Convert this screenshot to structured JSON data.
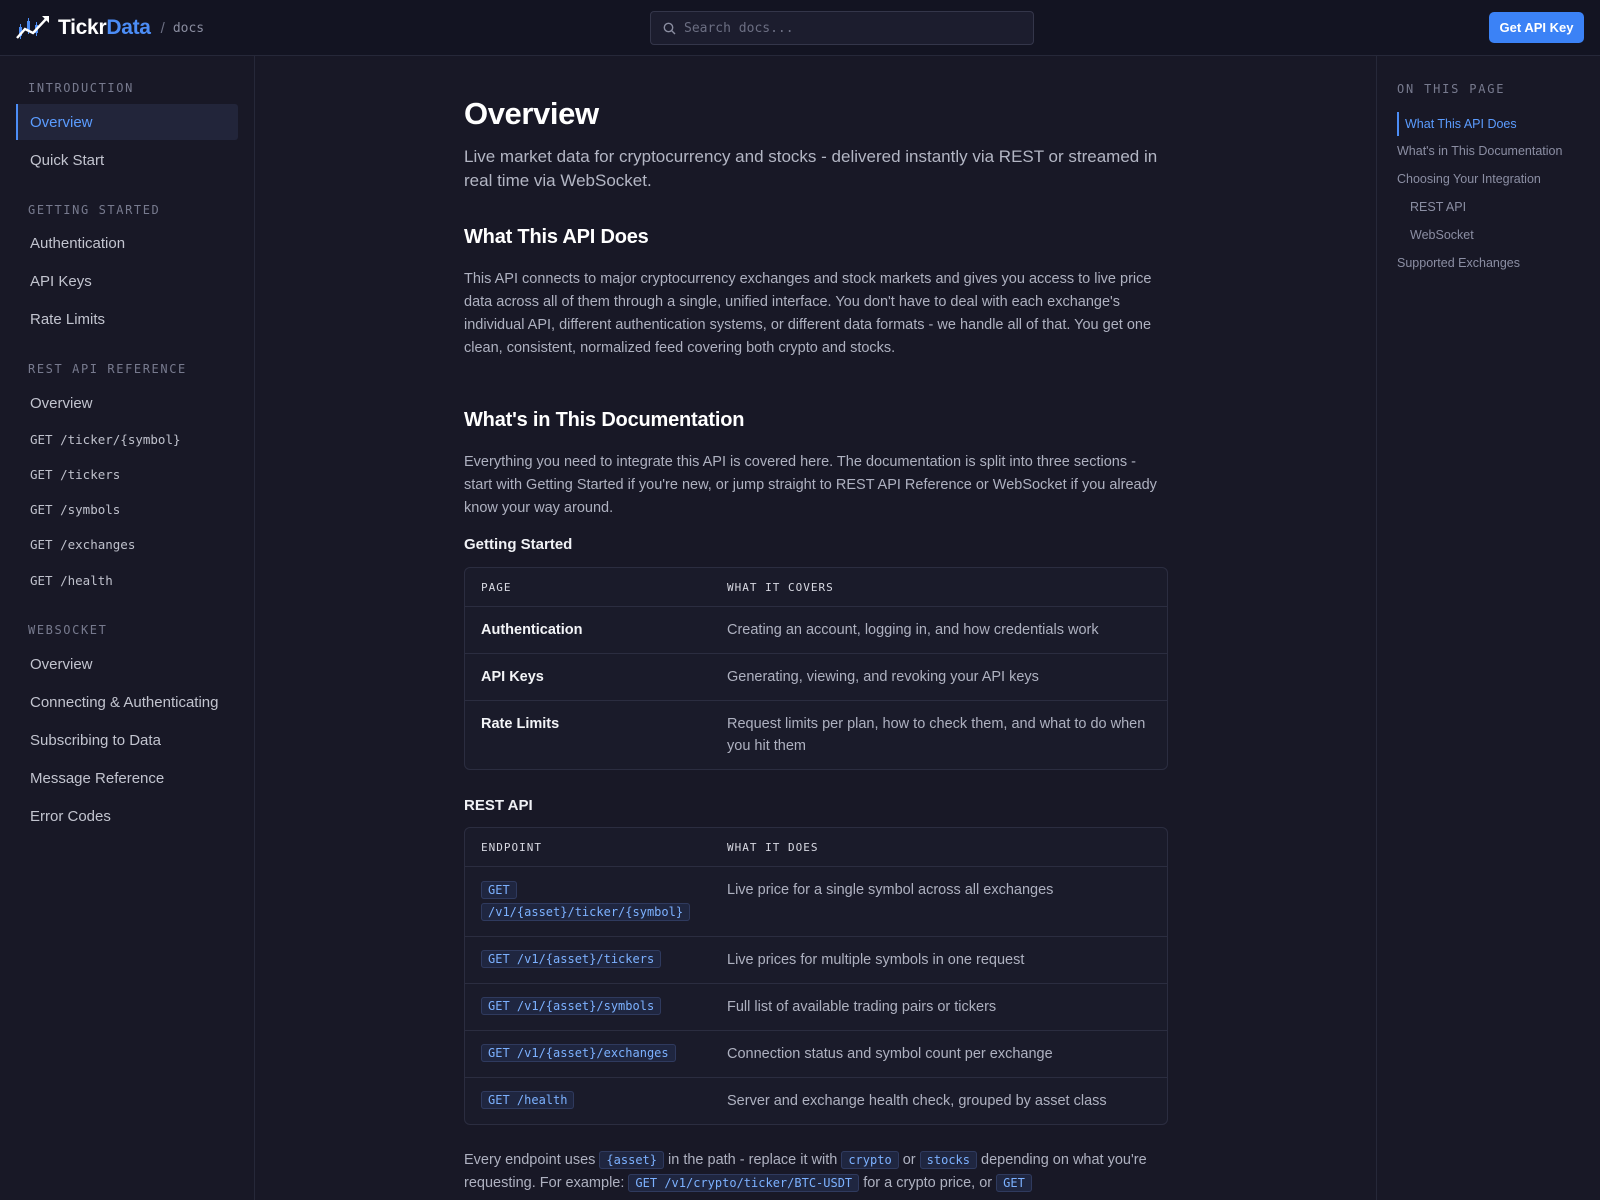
{
  "header": {
    "brand_part1": "Tickr",
    "brand_part2": "Data",
    "crumb_sep": "/",
    "crumb": "docs",
    "search_placeholder": "Search docs...",
    "cta_label": "Get API Key"
  },
  "sidebar": {
    "sections": [
      {
        "title": "INTRODUCTION",
        "items": [
          "Overview",
          "Quick Start"
        ]
      },
      {
        "title": "GETTING STARTED",
        "items": [
          "Authentication",
          "API Keys",
          "Rate Limits"
        ]
      },
      {
        "title": "REST API REFERENCE",
        "items": [
          "Overview",
          "GET /ticker/{symbol}",
          "GET /tickers",
          "GET /symbols",
          "GET /exchanges",
          "GET /health"
        ]
      },
      {
        "title": "WEBSOCKET",
        "items": [
          "Overview",
          "Connecting & Authenticating",
          "Subscribing to Data",
          "Message Reference",
          "Error Codes"
        ]
      }
    ]
  },
  "toc": {
    "title": "ON THIS PAGE",
    "items": [
      "What This API Does",
      "What's in This Documentation",
      "Choosing Your Integration",
      "REST API",
      "WebSocket",
      "Supported Exchanges"
    ]
  },
  "content": {
    "title": "Overview",
    "lead": "Live market data for cryptocurrency and stocks - delivered instantly via REST or streamed in real time via WebSocket.",
    "h2_what": "What This API Does",
    "p_what": "This API connects to major cryptocurrency exchanges and stock markets and gives you access to live price data across all of them through a single, unified interface. You don't have to deal with each exchange's individual API, different authentication systems, or different data formats - we handle all of that. You get one clean, consistent, normalized feed covering both crypto and stocks.",
    "h2_docs": "What's in This Documentation",
    "p_docs": "Everything you need to integrate this API is covered here. The documentation is split into three sections - start with Getting Started if you're new, or jump straight to REST API Reference or WebSocket if you already know your way around.",
    "h3_getting": "Getting Started",
    "table1": {
      "col1": "PAGE",
      "col2": "WHAT IT COVERS",
      "rows": [
        [
          "Authentication",
          "Creating an account, logging in, and how credentials work"
        ],
        [
          "API Keys",
          "Generating, viewing, and revoking your API keys"
        ],
        [
          "Rate Limits",
          "Request limits per plan, how to check them, and what to do when you hit them"
        ]
      ]
    },
    "h3_rest": "REST API",
    "table2": {
      "col1": "ENDPOINT",
      "col2": "WHAT IT DOES",
      "row1_code_a": "GET",
      "row1_code_b": "/v1/{asset}/ticker/{symbol}",
      "rows": [
        [
          "GET /v1/{asset}/ticker/{symbol}",
          "Live price for a single symbol across all exchanges"
        ],
        [
          "GET /v1/{asset}/tickers",
          "Live prices for multiple symbols in one request"
        ],
        [
          "GET /v1/{asset}/symbols",
          "Full list of available trading pairs or tickers"
        ],
        [
          "GET /v1/{asset}/exchanges",
          "Connection status and symbol count per exchange"
        ],
        [
          "GET /health",
          "Server and exchange health check, grouped by asset class"
        ]
      ]
    },
    "final": {
      "t1": "Every endpoint uses ",
      "c1": "{asset}",
      "t2": " in the path - replace it with ",
      "c2": "crypto",
      "t3": " or ",
      "c3": "stocks",
      "t4": " depending on what you're requesting. For example: ",
      "c4": "GET /v1/crypto/ticker/BTC-USDT",
      "t5": " for a crypto price, or ",
      "c5": "GET"
    }
  }
}
